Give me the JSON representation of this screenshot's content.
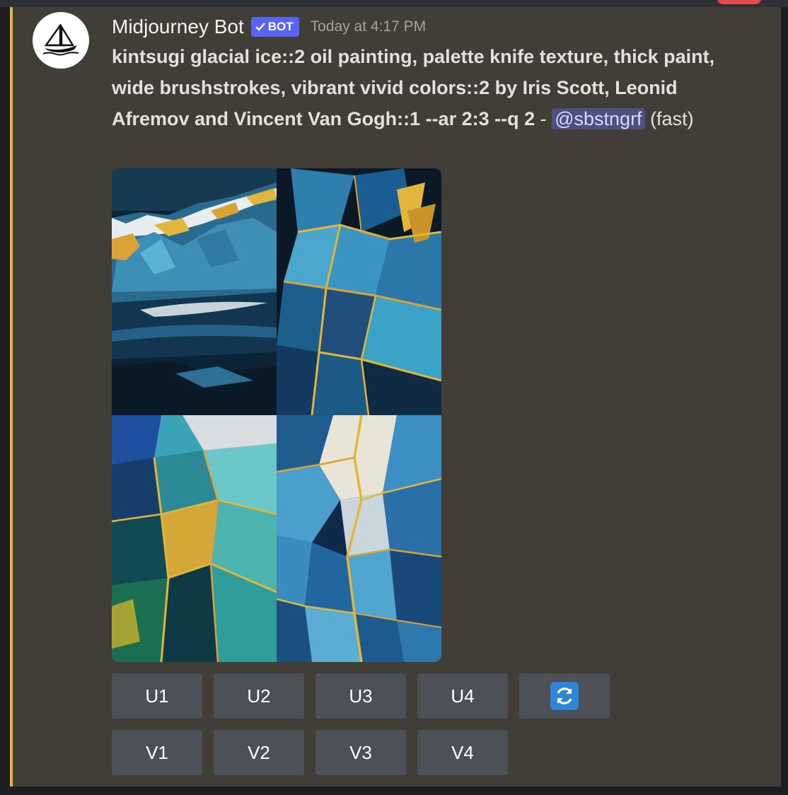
{
  "message": {
    "author": "Midjourney Bot",
    "badge": "BOT",
    "timestamp": "Today at 4:17 PM",
    "prompt_bold": "kintsugi glacial ice::2 oil painting, palette knife texture, thick paint, wide brushstrokes, vibrant vivid colors::2 by Iris Scott, Leonid Afremov and Vincent Van Gogh::1 --ar 2:3 --q 2",
    "prompt_separator": " - ",
    "mention": "@sbstngrf",
    "mode": " (fast)",
    "accent_color": "#e2b53c"
  },
  "buttons": {
    "upscale": [
      "U1",
      "U2",
      "U3",
      "U4"
    ],
    "variation": [
      "V1",
      "V2",
      "V3",
      "V4"
    ],
    "reroll_icon": "refresh-icon"
  },
  "colors": {
    "message_bg": "#413e38",
    "button_bg": "#4e5058",
    "badge_bg": "#5865f2",
    "reroll_icon_bg": "#2d86d6"
  }
}
